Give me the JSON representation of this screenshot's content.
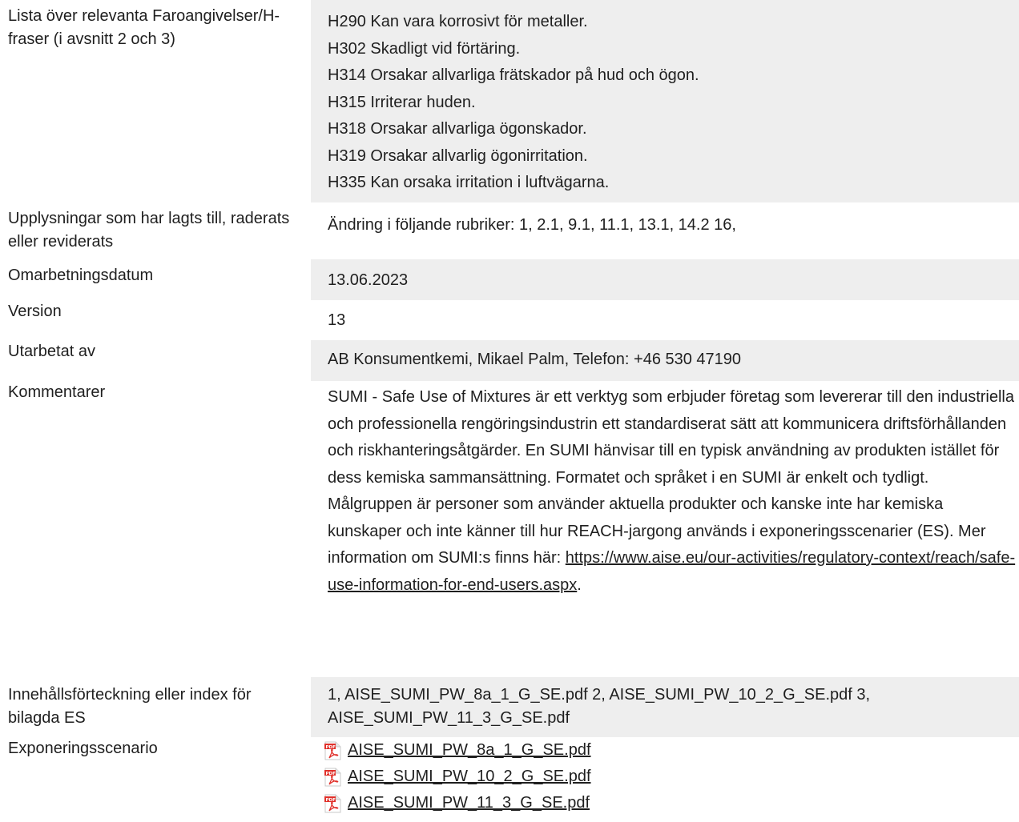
{
  "rows": {
    "hazard": {
      "label": "Lista över relevanta Faroangivelser/H-fraser (i avsnitt 2 och 3)",
      "items": [
        "H290 Kan vara korrosivt för metaller.",
        "H302 Skadligt vid förtäring.",
        "H314 Orsakar allvarliga frätskador på hud och ögon.",
        "H315 Irriterar huden.",
        "H318 Orsakar allvarliga ögonskador.",
        "H319 Orsakar allvarlig ögonirritation.",
        "H335 Kan orsaka irritation i luftvägarna."
      ]
    },
    "updates": {
      "label": "Upplysningar som har lagts till, raderats eller reviderats",
      "value": "Ändring i följande rubriker: 1, 2.1, 9.1, 11.1, 13.1, 14.2 16,"
    },
    "revision_date": {
      "label": "Omarbetningsdatum",
      "value": "13.06.2023"
    },
    "version": {
      "label": "Version",
      "value": "13"
    },
    "prepared_by": {
      "label": "Utarbetat av",
      "value": "AB Konsumentkemi, Mikael Palm, Telefon: +46 530 47190"
    },
    "comments": {
      "label": "Kommentarer",
      "text": "SUMI - Safe Use of Mixtures är ett verktyg som erbjuder företag som levererar till den industriella och professionella rengöringsindustrin ett standardiserat sätt att kommunicera driftsförhållanden och riskhanteringsåtgärder. En SUMI hänvisar till en typisk användning av produkten istället för dess kemiska sammansättning. Formatet och språket i en SUMI är enkelt och tydligt. Målgruppen är personer som använder aktuella produkter och kanske inte har kemiska kunskaper och inte känner till hur REACH-jargong används i exponeringsscenarier (ES). Mer information om SUMI:s finns här: ",
      "link": "https://www.aise.eu/our-activities/regulatory-context/reach/safe-use-information-for-end-users.aspx",
      "trailing": "."
    },
    "index": {
      "label": "Innehållsförteckning eller index för bilagda ES",
      "value": "1, AISE_SUMI_PW_8a_1_G_SE.pdf 2, AISE_SUMI_PW_10_2_G_SE.pdf 3, AISE_SUMI_PW_11_3_G_SE.pdf"
    },
    "exposure": {
      "label": "Exponeringsscenario",
      "files": [
        "AISE_SUMI_PW_8a_1_G_SE.pdf",
        "AISE_SUMI_PW_10_2_G_SE.pdf",
        "AISE_SUMI_PW_11_3_G_SE.pdf"
      ],
      "icon": "pdf-file-icon"
    }
  },
  "colors": {
    "shaded_background": "#eeeeee",
    "text": "#1f1f1f",
    "pdf_red": "#e0302a"
  }
}
